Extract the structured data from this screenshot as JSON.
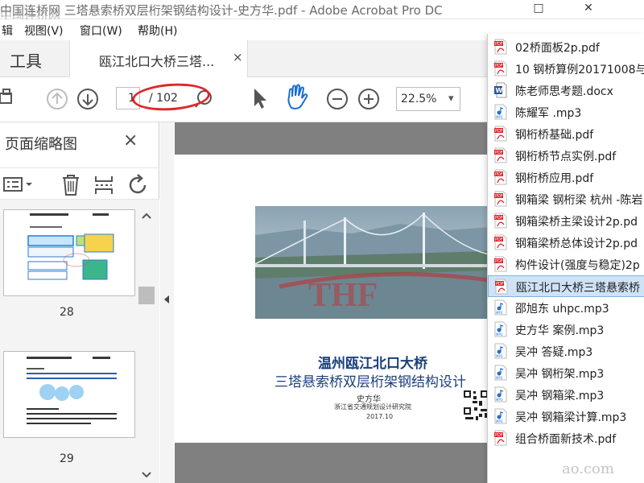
{
  "window": {
    "title": "中国连桥网 三塔悬索桥双层桁架钢结构设计-史方华.pdf - Adobe Acrobat Pro DC",
    "minimize": "–",
    "maximize": "□",
    "close": "✕"
  },
  "watermark": {
    "top": "中国连桥网",
    "bottom": "ao.com"
  },
  "menu": {
    "edit": "辑",
    "view": "视图(V)",
    "window": "窗口(W)",
    "help": "帮助(H)"
  },
  "tabs": {
    "tools": "工具",
    "document": "瓯江北口大桥三塔...",
    "close": "×"
  },
  "toolbar": {
    "page_current": "1",
    "page_total": "/ 102",
    "zoom": "22.5%",
    "zoom_arrow": "▾"
  },
  "sidebar": {
    "title": "页面缩略图",
    "close": "×",
    "pages": [
      {
        "number": "28"
      },
      {
        "number": "29"
      }
    ]
  },
  "pdf": {
    "title_line1": "温州瓯江北口大桥",
    "title_line2": "三塔悬索桥双层桁架钢结构设计",
    "author": "史方华",
    "org": "浙江省交通规划设计研究院",
    "date": "2017.10",
    "stamp": "THF"
  },
  "file_list": [
    {
      "name": "02桥面板2p.pdf",
      "type": "pdf"
    },
    {
      "name": "10 钢桥算例20171008与",
      "type": "pdf"
    },
    {
      "name": "陈老师思考题.docx",
      "type": "docx"
    },
    {
      "name": "陈耀军 .mp3",
      "type": "mp3"
    },
    {
      "name": "钢桁桥基础.pdf",
      "type": "pdf"
    },
    {
      "name": "钢桁桥节点实例.pdf",
      "type": "pdf"
    },
    {
      "name": "钢桁桥应用.pdf",
      "type": "pdf"
    },
    {
      "name": "钢箱梁 钢桁梁 杭州 -陈岩",
      "type": "pdf"
    },
    {
      "name": "钢箱梁桥主梁设计2p.pd",
      "type": "pdf"
    },
    {
      "name": "钢箱梁桥总体设计2p.pd",
      "type": "pdf"
    },
    {
      "name": "构件设计(强度与稳定)2p",
      "type": "pdf"
    },
    {
      "name": "瓯江北口大桥三塔悬索桥",
      "type": "pdf",
      "selected": true
    },
    {
      "name": "邵旭东 uhpc.mp3",
      "type": "mp3"
    },
    {
      "name": "史方华 案例.mp3",
      "type": "mp3"
    },
    {
      "name": "吴冲 答疑.mp3",
      "type": "mp3"
    },
    {
      "name": "吴冲 钢桁架.mp3",
      "type": "mp3"
    },
    {
      "name": "吴冲 钢箱梁.mp3",
      "type": "mp3"
    },
    {
      "name": "吴冲 钢箱梁计算.mp3",
      "type": "mp3"
    },
    {
      "name": "组合桥面新技术.pdf",
      "type": "pdf"
    }
  ],
  "colors": {
    "accent_blue": "#1a6fd0",
    "pdf_title": "#1a3f7a",
    "annotation_red": "#e0262b",
    "selected_bg": "#cfe3f7"
  }
}
